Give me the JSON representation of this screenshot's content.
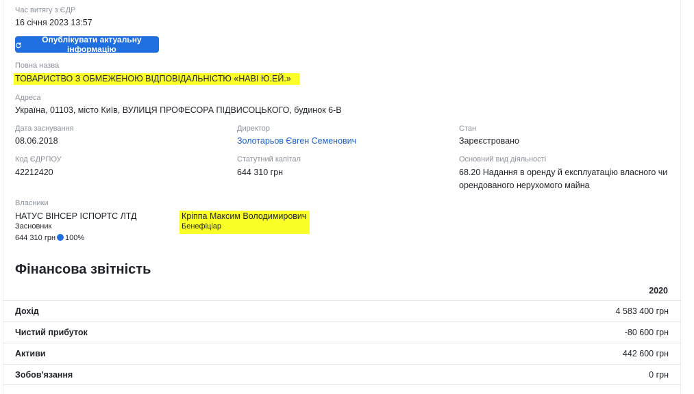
{
  "extract": {
    "label": "Час витягу з ЄДР",
    "value": "16 січня 2023 13:57"
  },
  "publish_button": {
    "label": "Опублікувати актуальну інформацію"
  },
  "full_name": {
    "label": "Повна назва",
    "value": "ТОВАРИСТВО З ОБМЕЖЕНОЮ ВІДПОВІДАЛЬНІСТЮ «НАВІ Ю.ЕЙ.»"
  },
  "address": {
    "label": "Адреса",
    "value": "Україна, 01103, місто Київ, ВУЛИЦЯ ПРОФЕСОРА ПІДВИСОЦЬКОГО, будинок 6-В"
  },
  "founded": {
    "label": "Дата заснування",
    "value": "08.06.2018"
  },
  "director": {
    "label": "Директор",
    "value": "Золотарьов Євген Семенович"
  },
  "status": {
    "label": "Стан",
    "value": "Зареєстровано"
  },
  "edrpou": {
    "label": "Код ЄДРПОУ",
    "value": "42212420"
  },
  "capital": {
    "label": "Статутний капітал",
    "value": "644 310 грн"
  },
  "activity": {
    "label": "Основний вид діяльності",
    "line1": "68.20 Надання в оренду й експлуатацію власного чи",
    "line2": "орендованого нерухомого майна"
  },
  "owners": {
    "label": "Власники",
    "items": [
      {
        "name": "НАТУС ВІНСЕР ІСПОРТС ЛТД",
        "role": "Засновник",
        "amount": "644 310 грн",
        "share": "100%"
      },
      {
        "name": "Кріппа Максим Володимирович",
        "role": "Бенефіціар"
      }
    ]
  },
  "finance": {
    "title": "Фінансова звітність",
    "year": "2020",
    "rows": [
      {
        "label": "Дохід",
        "value": "4 583 400 грн"
      },
      {
        "label": "Чистий прибуток",
        "value": "-80 600 грн"
      },
      {
        "label": "Активи",
        "value": "442 600 грн"
      },
      {
        "label": "Зобов'язання",
        "value": "0 грн"
      }
    ]
  },
  "colors": {
    "accent": "#1f6fe0",
    "link": "#1a5fd1",
    "highlight": "#fbff28"
  }
}
